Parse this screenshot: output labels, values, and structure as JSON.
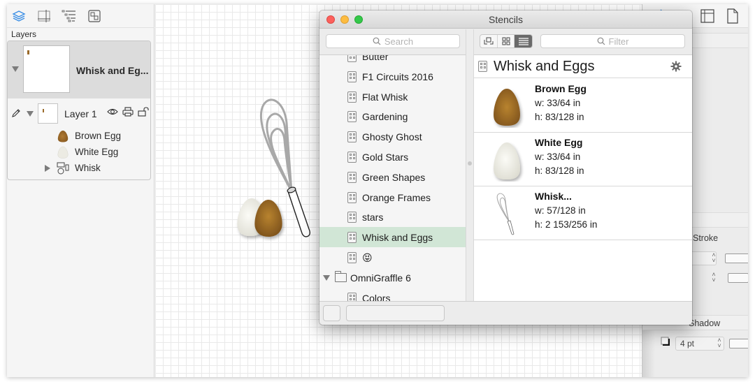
{
  "sidebar": {
    "tools": [
      {
        "name": "layers-tool",
        "icon": "layers-icon",
        "active": true
      },
      {
        "name": "canvas-size-tool",
        "icon": "canvas-size-icon"
      },
      {
        "name": "outline-tool",
        "icon": "outline-icon"
      },
      {
        "name": "group-tool",
        "icon": "group-icon"
      }
    ],
    "section_label": "Layers",
    "canvas": {
      "title": "Whisk and Eg..."
    },
    "layer": {
      "name": "Layer 1"
    },
    "shapes": [
      {
        "name": "Brown Egg",
        "color": "#9c6a2c"
      },
      {
        "name": "White Egg",
        "color": "#ecebe3"
      },
      {
        "name": "Whisk",
        "expandable": true
      }
    ]
  },
  "stencils_window": {
    "title": "Stencils",
    "search": {
      "placeholder": "Search",
      "value": ""
    },
    "filter": {
      "placeholder": "Filter",
      "value": ""
    },
    "list": [
      {
        "label": "Butter",
        "type": "stencil"
      },
      {
        "label": "F1 Circuits 2016",
        "type": "stencil"
      },
      {
        "label": "Flat Whisk",
        "type": "stencil"
      },
      {
        "label": "Gardening",
        "type": "stencil"
      },
      {
        "label": "Ghosty Ghost",
        "type": "stencil"
      },
      {
        "label": "Gold Stars",
        "type": "stencil"
      },
      {
        "label": "Green Shapes",
        "type": "stencil"
      },
      {
        "label": "Orange Frames",
        "type": "stencil"
      },
      {
        "label": "stars",
        "type": "stencil"
      },
      {
        "label": "Whisk and Eggs",
        "type": "stencil",
        "selected": true
      },
      {
        "label": "😝",
        "type": "stencil"
      },
      {
        "label": "OmniGraffle 6",
        "type": "folder"
      },
      {
        "label": "Colors",
        "type": "stencil"
      }
    ],
    "view_modes": [
      "arrange",
      "grid",
      "list"
    ],
    "active_view_mode": "list",
    "detail": {
      "title": "Whisk and Eggs",
      "items": [
        {
          "name": "Brown Egg",
          "w": "w: 33/64 in",
          "h": "h: 83/128 in"
        },
        {
          "name": "White Egg",
          "w": "w: 33/64 in",
          "h": "h: 83/128 in"
        },
        {
          "name": "Whisk...",
          "w": "w: 57/128 in",
          "h": "h: 2 153/256 in"
        }
      ]
    },
    "selection_color": "#d1e6d6"
  },
  "inspector": {
    "stroke_label": "Stroke",
    "shadow_label": "Shadow",
    "shadow_size": "4 pt",
    "accent_color": "#3a8ee6"
  }
}
